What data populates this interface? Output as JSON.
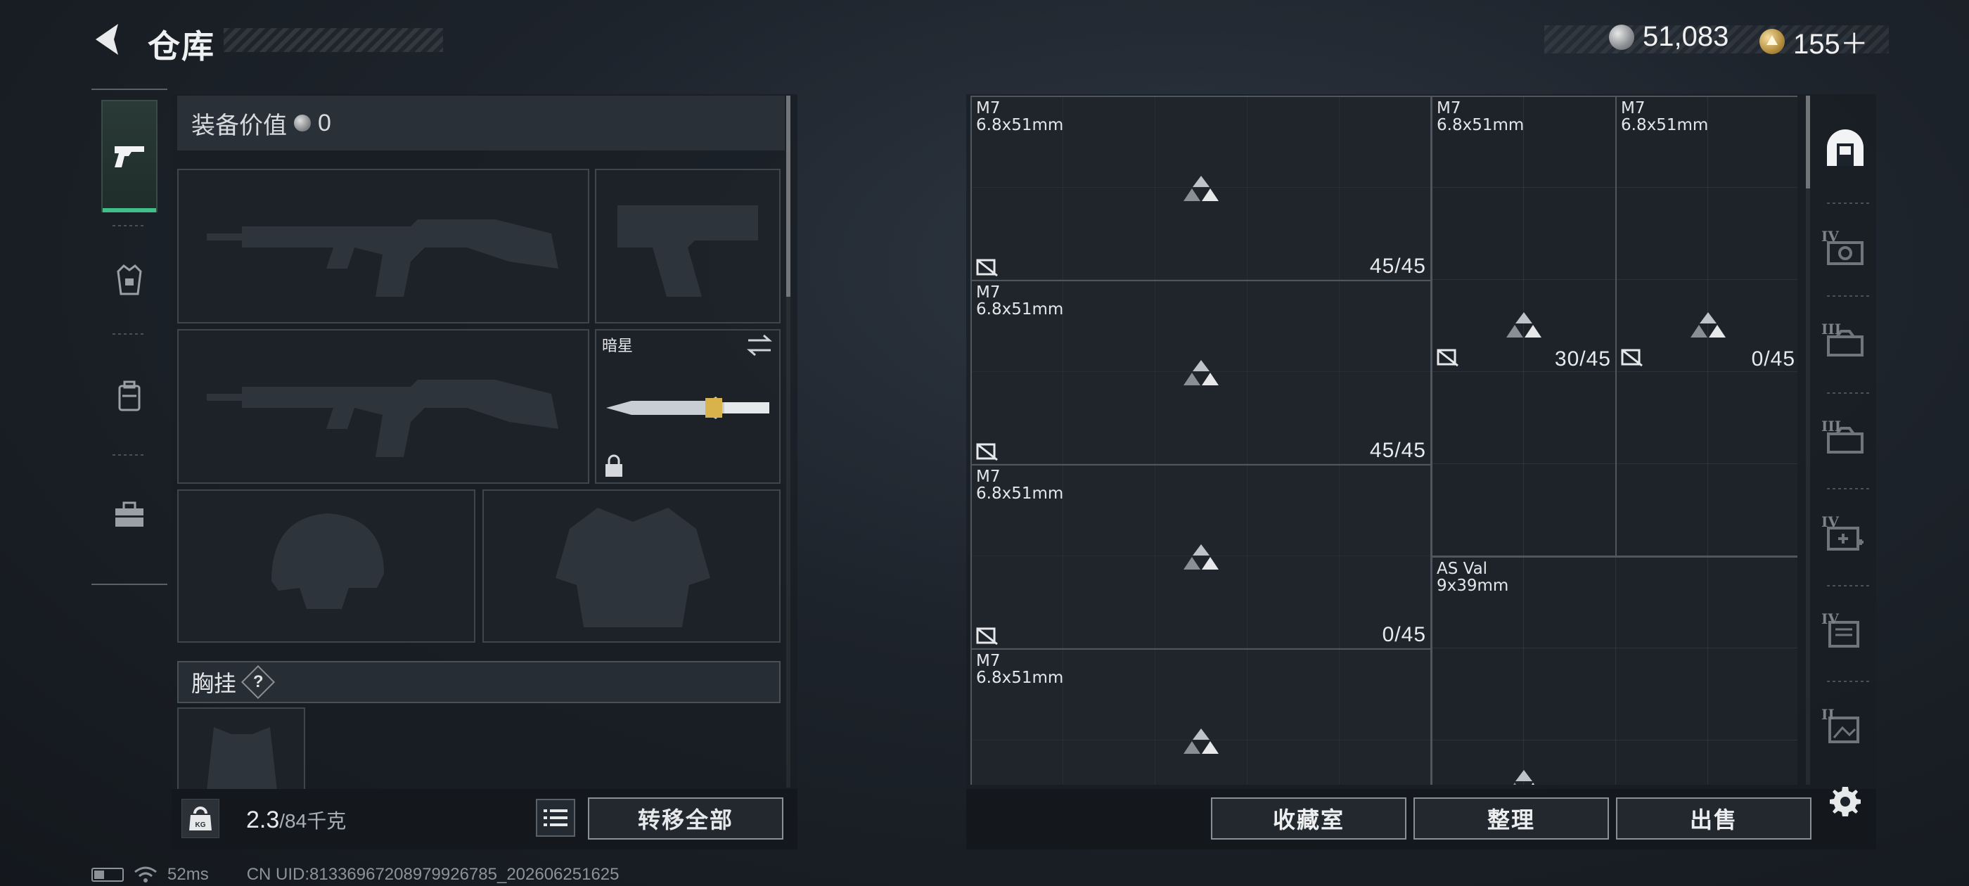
{
  "header": {
    "title": "仓库",
    "currency_silver": "51,083",
    "currency_gold": "155＋"
  },
  "categories": [
    {
      "name": "weapons",
      "icon": "pistol-icon",
      "active": true
    },
    {
      "name": "armor",
      "icon": "vest-icon",
      "active": false
    },
    {
      "name": "backpack",
      "icon": "backpack-icon",
      "active": false
    },
    {
      "name": "toolbox",
      "icon": "toolbox-icon",
      "active": false
    }
  ],
  "equipment": {
    "value_label": "装备价值",
    "value": "0",
    "knife_name": "暗星",
    "chest_rig_label": "胸挂",
    "chest_rig_help": "?"
  },
  "inventory": {
    "weight_current": "2.3",
    "weight_max": "/84千克",
    "transfer_all": "转移全部"
  },
  "status": {
    "ping": "52ms",
    "uid": "CN UID:81336967208979926785_202606251625"
  },
  "grid_items": [
    {
      "name": "M7",
      "caliber": "6.8x51mm",
      "count": "45/45"
    },
    {
      "name": "M7",
      "caliber": "6.8x51mm",
      "count": "30/45"
    },
    {
      "name": "M7",
      "caliber": "6.8x51mm",
      "count": "0/45"
    },
    {
      "name": "M7",
      "caliber": "6.8x51mm",
      "count": "45/45"
    },
    {
      "name": "M7",
      "caliber": "6.8x51mm",
      "count": "0/45"
    },
    {
      "name": "AS Val",
      "caliber": "9x39mm",
      "count": ""
    },
    {
      "name": "M7",
      "caliber": "6.8x51mm",
      "count": ""
    }
  ],
  "containers": [
    {
      "icon": "safe-icon",
      "level": ""
    },
    {
      "icon": "camera-case-icon",
      "level": "IV"
    },
    {
      "icon": "ammo-case-icon",
      "level": "III"
    },
    {
      "icon": "ammo-case-icon",
      "level": "III"
    },
    {
      "icon": "medkit-case-icon",
      "level": "IV"
    },
    {
      "icon": "document-case-icon",
      "level": "IV"
    },
    {
      "icon": "photo-case-icon",
      "level": "II"
    }
  ],
  "actions": {
    "collection": "收藏室",
    "sort": "整理",
    "sell": "出售"
  },
  "colors": {
    "accent": "#3fbf8a",
    "panel": "#1d2228",
    "border": "#4f565e"
  }
}
